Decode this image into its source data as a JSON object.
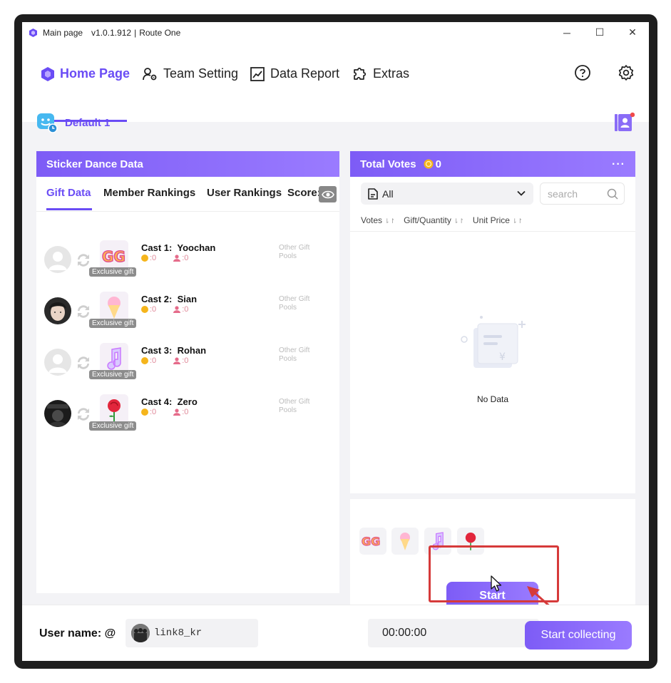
{
  "window": {
    "title": "Main page",
    "version": "v1.0.1.912",
    "separator": "|",
    "route": "Route One",
    "controls": {
      "minimize": "─",
      "maximize": "☐",
      "close": "✕"
    }
  },
  "nav": {
    "tabs": [
      {
        "label": "Home Page",
        "icon": "hexagon-icon",
        "active": true
      },
      {
        "label": "Team Setting",
        "icon": "user-gear-icon",
        "active": false
      },
      {
        "label": "Data Report",
        "icon": "chart-icon",
        "active": false
      },
      {
        "label": "Extras",
        "icon": "puzzle-icon",
        "active": false
      }
    ],
    "right_icons": [
      "help-icon",
      "settings-icon"
    ]
  },
  "profile": {
    "name": "Default 1"
  },
  "left_panel": {
    "title": "Sticker Dance Data",
    "tabs": [
      "Gift Data",
      "Member Rankings",
      "User Rankings",
      "Score:"
    ],
    "active_tab": "Gift Data",
    "casts": [
      {
        "label": "Cast 1:",
        "name": "Yoochan",
        "coins": ":0",
        "people": ":0",
        "badge": "Exclusive gift",
        "pool": "Other Gift Pools",
        "gift": "GG"
      },
      {
        "label": "Cast 2:",
        "name": "Sian",
        "coins": ":0",
        "people": ":0",
        "badge": "Exclusive gift",
        "pool": "Other Gift Pools",
        "gift": "ice-cream"
      },
      {
        "label": "Cast 3:",
        "name": "Rohan",
        "coins": ":0",
        "people": ":0",
        "badge": "Exclusive gift",
        "pool": "Other Gift Pools",
        "gift": "music-note"
      },
      {
        "label": "Cast 4:",
        "name": "Zero",
        "coins": ":0",
        "people": ":0",
        "badge": "Exclusive gift",
        "pool": "Other Gift Pools",
        "gift": "rose"
      }
    ]
  },
  "right_panel": {
    "title": "Total Votes",
    "votes": "0",
    "more": "···",
    "filter": {
      "value": "All"
    },
    "search": {
      "placeholder": "search"
    },
    "columns": [
      "Votes",
      "Gift/Quantity",
      "Unit Price"
    ],
    "sort_glyph": "⇂↾",
    "empty_text": "No Data"
  },
  "start_area": {
    "gifts": [
      "GG",
      "ice-cream",
      "music-note",
      "rose"
    ],
    "start_label": "Start"
  },
  "footer": {
    "user_label": "User name: @",
    "username": "link8_kr",
    "timer": "00:00:00",
    "collect_label": "Start collecting"
  },
  "colors": {
    "accent": "#6a4cf5",
    "highlight": "#d63a3a",
    "coin": "#f5b51c"
  }
}
